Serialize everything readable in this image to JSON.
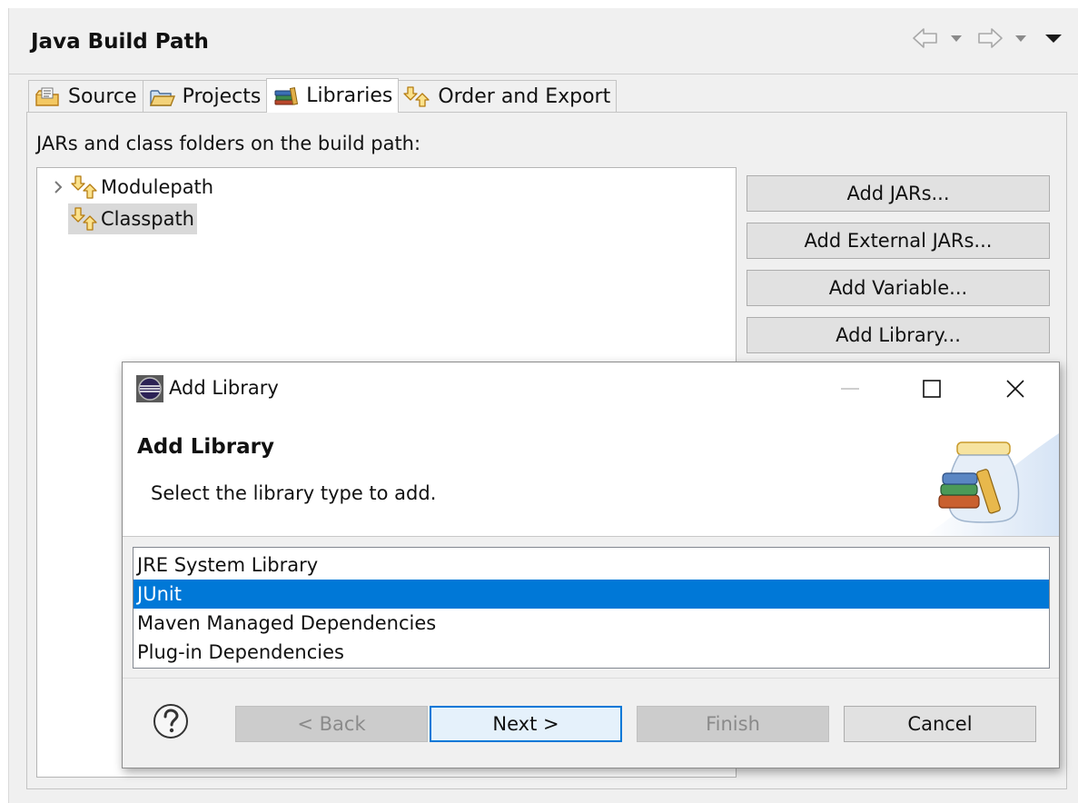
{
  "page": {
    "title": "Java Build Path",
    "tabs": [
      {
        "label": "Source",
        "icon": "source-folder-icon"
      },
      {
        "label": "Projects",
        "icon": "projects-folder-icon"
      },
      {
        "label": "Libraries",
        "icon": "libraries-books-icon",
        "active": true
      },
      {
        "label": "Order and Export",
        "icon": "order-arrows-icon"
      }
    ],
    "section_label": "JARs and class folders on the build path:",
    "tree": [
      {
        "label": "Modulepath",
        "expandable": true,
        "selected": false
      },
      {
        "label": "Classpath",
        "expandable": false,
        "selected": true
      }
    ],
    "side_buttons": [
      "Add JARs...",
      "Add External JARs...",
      "Add Variable...",
      "Add Library..."
    ]
  },
  "dialog": {
    "window_title": "Add Library",
    "heading": "Add Library",
    "description": "Select the library type to add.",
    "library_types": [
      {
        "label": "JRE System Library",
        "selected": false
      },
      {
        "label": "JUnit",
        "selected": true
      },
      {
        "label": "Maven Managed Dependencies",
        "selected": false
      },
      {
        "label": "Plug-in Dependencies",
        "selected": false
      }
    ],
    "buttons": {
      "back": "< Back",
      "next": "Next >",
      "finish": "Finish",
      "cancel": "Cancel"
    }
  },
  "colors": {
    "selection": "#0078d7",
    "tree_selection": "#d9d9d9",
    "background": "#f0f0f0"
  }
}
